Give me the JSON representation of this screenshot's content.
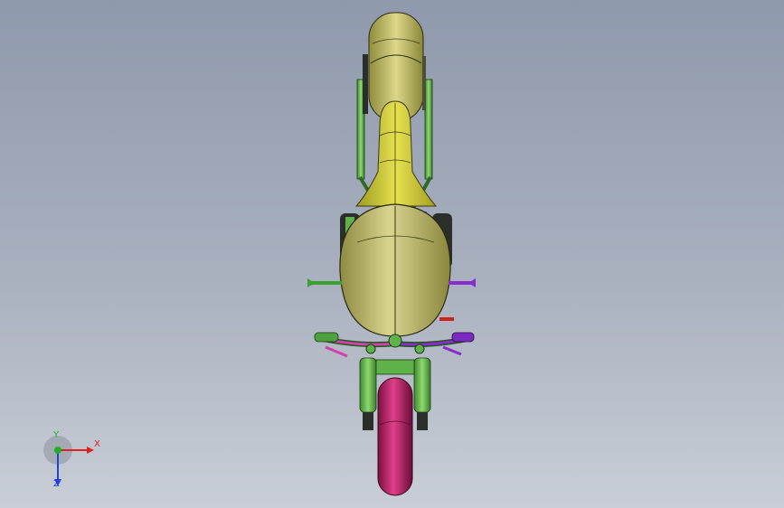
{
  "viewport": {
    "background_top": "#8e99ab",
    "background_bottom": "#c9ced6"
  },
  "model": {
    "colors": {
      "body_yellow": "#c9c46a",
      "tank_olive": "#b9b66a",
      "frame_green": "#5fb24a",
      "tire_magenta": "#c0206a",
      "handle_purple": "#8a2bd0",
      "handle_pink": "#d040b0",
      "accent_blue": "#2050d0",
      "accent_red": "#d02020",
      "dark_part": "#2b2f2a"
    }
  },
  "triad": {
    "x_label": "X",
    "y_label": "Y",
    "z_label": "Z",
    "x_color": "#e02020",
    "y_color": "#20b020",
    "z_color": "#2040e0"
  }
}
